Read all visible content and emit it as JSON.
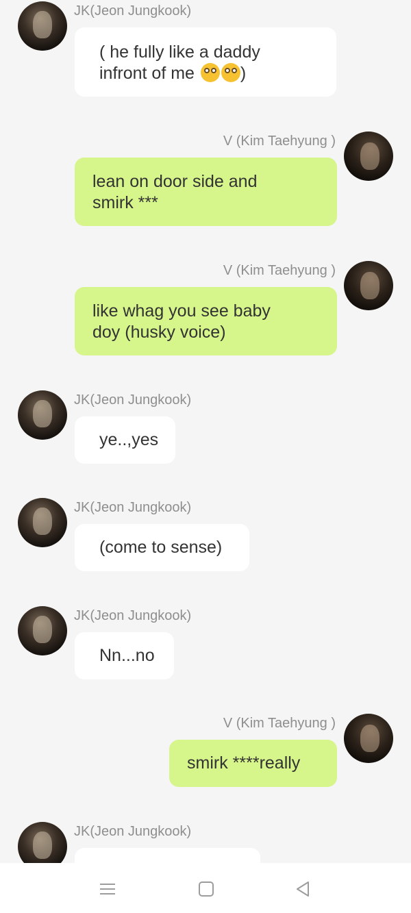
{
  "messages": [
    {
      "sender": "JK(Jeon Jungkook)",
      "side": "left",
      "text_lines": [
        "( he fully like a daddy",
        "infront of  me"
      ]
    },
    {
      "sender": "V (Kim Taehyung )",
      "side": "right",
      "text_lines": [
        "lean on door side and",
        "smirk ***"
      ]
    },
    {
      "sender": "V (Kim Taehyung )",
      "side": "right",
      "text_lines": [
        "like whag you see baby",
        "doy (husky voice)"
      ]
    },
    {
      "sender": "JK(Jeon Jungkook)",
      "side": "left",
      "text": "ye..,yes"
    },
    {
      "sender": "JK(Jeon Jungkook)",
      "side": "left",
      "text": "(come to sense)"
    },
    {
      "sender": "JK(Jeon Jungkook)",
      "side": "left",
      "text": "Nn...no"
    },
    {
      "sender": "V (Kim Taehyung )",
      "side": "right",
      "text": "smirk ****really"
    },
    {
      "sender": "JK(Jeon Jungkook)",
      "side": "left",
      "text": ""
    }
  ],
  "emoji": {
    "name": "flushed-face-emoji",
    "count": 2,
    "closing": ")"
  },
  "navbar": {
    "icons": [
      "menu-icon",
      "home-icon",
      "back-icon"
    ]
  },
  "colors": {
    "outgoing_bubble": "#d6f58a",
    "incoming_bubble": "#ffffff",
    "background": "#f5f5f5",
    "name_text": "#8e8e8e"
  }
}
